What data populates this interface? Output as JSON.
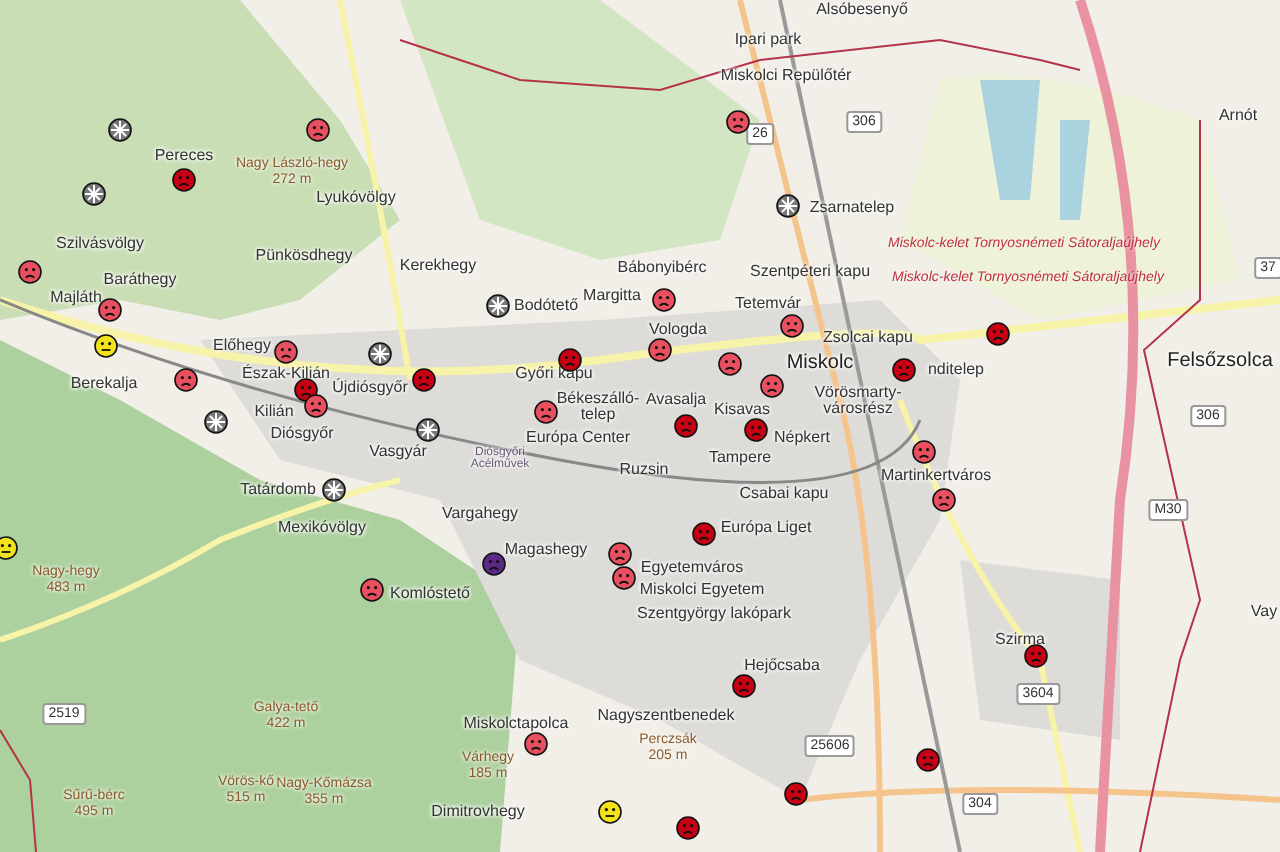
{
  "map": {
    "places": [
      {
        "name": "Alsóbesenyő"
      },
      {
        "name": "Ipari park"
      },
      {
        "name": "Miskolci Repülőtér"
      },
      {
        "name": "Arnót"
      },
      {
        "name": "Zsarnatelep"
      },
      {
        "name": "Pereces"
      },
      {
        "name": "Lyukóvölgy"
      },
      {
        "name": "Pünkösdhegy"
      },
      {
        "name": "Szilvásvölgy"
      },
      {
        "name": "Baráthegy"
      },
      {
        "name": "Majláth"
      },
      {
        "name": "Kerekhegy"
      },
      {
        "name": "Bodótető"
      },
      {
        "name": "Margitta"
      },
      {
        "name": "Bábonyibérc"
      },
      {
        "name": "Szentpéteri kapu"
      },
      {
        "name": "Tetemvár"
      },
      {
        "name": "Előhegy"
      },
      {
        "name": "Berekalja"
      },
      {
        "name": "Észak-Kilián"
      },
      {
        "name": "Újdiósgyőr"
      },
      {
        "name": "Vologda"
      },
      {
        "name": "Zsolcai kapu"
      },
      {
        "name": "Miskolc"
      },
      {
        "name": "nditelep"
      },
      {
        "name": "Felsőzsolca"
      },
      {
        "name": "Kilián"
      },
      {
        "name": "Győri kapu"
      },
      {
        "name": "Békeszálló-telep"
      },
      {
        "name": "Avasalja"
      },
      {
        "name": "Kisavas"
      },
      {
        "name": "Vörösmarty-városrész"
      },
      {
        "name": "Diósgyőr"
      },
      {
        "name": "Népkert"
      },
      {
        "name": "Vasgyár"
      },
      {
        "name": "Diósgyőri Acélművek"
      },
      {
        "name": "Európa Center"
      },
      {
        "name": "Tampere"
      },
      {
        "name": "Ruzsin"
      },
      {
        "name": "Martinkertváros"
      },
      {
        "name": "Tatárdomb"
      },
      {
        "name": "Csabai kapu"
      },
      {
        "name": "Vargahegy"
      },
      {
        "name": "Mexikóvölgy"
      },
      {
        "name": "Európa Liget"
      },
      {
        "name": "Magashegy"
      },
      {
        "name": "Egyetemváros"
      },
      {
        "name": "Komlóstető"
      },
      {
        "name": "Miskolci Egyetem"
      },
      {
        "name": "Szentgyörgy lakópark"
      },
      {
        "name": "Szirma"
      },
      {
        "name": "Hejőcsaba"
      },
      {
        "name": "Nagyszentbenedek"
      },
      {
        "name": "Miskolctapolca"
      },
      {
        "name": "Dimitrovhegy"
      },
      {
        "name": "Vay"
      }
    ],
    "peaks": [
      {
        "name": "Nagy László-hegy",
        "elevation": "272 m"
      },
      {
        "name": "Nagy-hegy",
        "elevation": "483 m"
      },
      {
        "name": "Galya-tető",
        "elevation": "422 m"
      },
      {
        "name": "Várhegy",
        "elevation": "185 m"
      },
      {
        "name": "Perczsák",
        "elevation": "205 m"
      },
      {
        "name": "Vörös-kő",
        "elevation": "515 m"
      },
      {
        "name": "Nagy-Kőmázsa",
        "elevation": "355 m"
      },
      {
        "name": "Sűrű-bérc",
        "elevation": "495 m"
      }
    ],
    "road_numbers": [
      "26",
      "306",
      "306",
      "37",
      "M30",
      "3604",
      "304",
      "25606",
      "2519"
    ],
    "border_labels": [
      "Miskolc-kelet Tornyosnémeti Sátoraljaújhely",
      "Miskolc-kelet Tornyosnémeti Sátoraljaújhely"
    ],
    "markers": [
      {
        "kind": "sad",
        "color": "#e8505f"
      },
      {
        "kind": "sad",
        "color": "#c80014"
      },
      {
        "kind": "sad",
        "color": "#e8505f"
      },
      {
        "kind": "sad",
        "color": "#e8505f"
      },
      {
        "kind": "neutral",
        "color": "#f2e21c"
      },
      {
        "kind": "sad",
        "color": "#e8505f"
      },
      {
        "kind": "sad",
        "color": "#e8505f"
      },
      {
        "kind": "sad",
        "color": "#c80014"
      },
      {
        "kind": "sad",
        "color": "#e8505f"
      },
      {
        "kind": "sad",
        "color": "#c80014"
      },
      {
        "kind": "sad",
        "color": "#c80014"
      },
      {
        "kind": "sad",
        "color": "#e8505f"
      },
      {
        "kind": "sad",
        "color": "#e8505f"
      },
      {
        "kind": "sad",
        "color": "#e8505f"
      },
      {
        "kind": "sad",
        "color": "#e8505f"
      },
      {
        "kind": "sad",
        "color": "#e8505f"
      },
      {
        "kind": "sad",
        "color": "#e8505f"
      },
      {
        "kind": "sad",
        "color": "#c80014"
      },
      {
        "kind": "sad",
        "color": "#c80014"
      },
      {
        "kind": "sad",
        "color": "#e8505f"
      },
      {
        "kind": "sad",
        "color": "#c80014"
      },
      {
        "kind": "sad",
        "color": "#c80014"
      },
      {
        "kind": "sad",
        "color": "#e8505f"
      },
      {
        "kind": "sad",
        "color": "#e8505f"
      },
      {
        "kind": "sad",
        "color": "#c80014"
      },
      {
        "kind": "sad",
        "color": "#c80014"
      },
      {
        "kind": "sad",
        "color": "#c80014"
      },
      {
        "kind": "sad",
        "color": "#e8505f"
      },
      {
        "kind": "sad",
        "color": "#e8505f"
      },
      {
        "kind": "sad",
        "color": "#e8505f"
      },
      {
        "kind": "sad",
        "color": "#5b2a86"
      },
      {
        "kind": "sad",
        "color": "#c80014"
      },
      {
        "kind": "sad",
        "color": "#e8505f"
      },
      {
        "kind": "neutral",
        "color": "#f2e21c"
      },
      {
        "kind": "sad",
        "color": "#c80014"
      },
      {
        "kind": "sad",
        "color": "#c80014"
      },
      {
        "kind": "neutral",
        "color": "#f2e21c"
      },
      {
        "kind": "nodata",
        "color": "#777777"
      },
      {
        "kind": "nodata",
        "color": "#777777"
      },
      {
        "kind": "nodata",
        "color": "#777777"
      },
      {
        "kind": "nodata",
        "color": "#777777"
      },
      {
        "kind": "nodata",
        "color": "#777777"
      },
      {
        "kind": "nodata",
        "color": "#777777"
      },
      {
        "kind": "nodata",
        "color": "#777777"
      },
      {
        "kind": "nodata",
        "color": "#777777"
      }
    ]
  }
}
